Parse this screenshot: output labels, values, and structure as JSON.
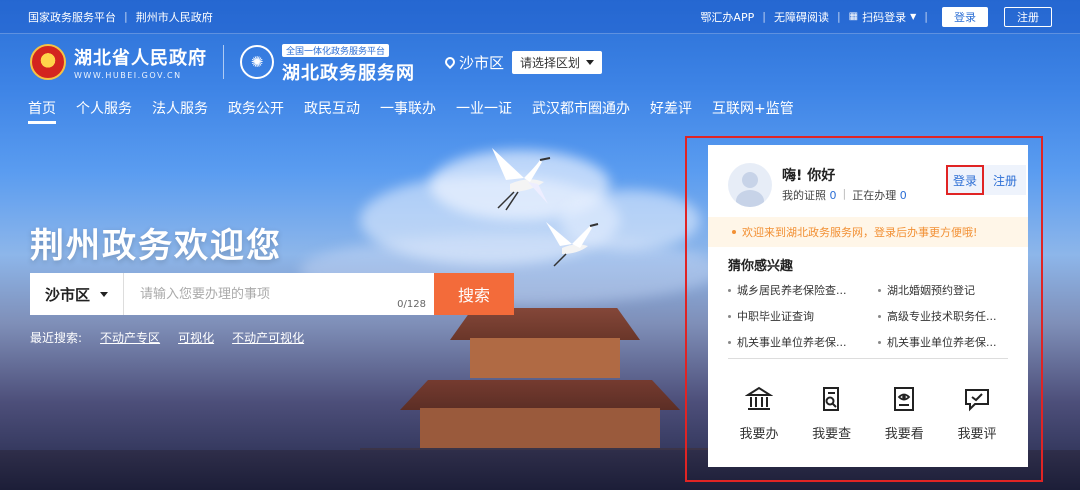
{
  "topbar": {
    "links": [
      "国家政务服务平台",
      "荆州市人民政府"
    ],
    "separator": "|",
    "app": "鄂汇办APP",
    "accessible": "无障碍阅读",
    "scan_login": "扫码登录",
    "login": "登录",
    "register": "注册"
  },
  "brand": {
    "gov_cn": "湖北省人民政府",
    "gov_en": "WWW.HUBEI.GOV.CN",
    "svc_tag": "全国一体化政务服务平台",
    "svc_title": "湖北政务服务网",
    "location": "沙市区",
    "area_select": "请选择区划"
  },
  "nav": [
    "首页",
    "个人服务",
    "法人服务",
    "政务公开",
    "政民互动",
    "一事联办",
    "一业一证",
    "武汉都市圈通办",
    "好差评",
    "互联网+监管"
  ],
  "hero": {
    "welcome": "荆州政务欢迎您"
  },
  "search": {
    "region": "沙市区",
    "placeholder": "请输入您要办理的事项",
    "counter": "0/128",
    "button": "搜索"
  },
  "recent": {
    "label": "最近搜索:",
    "items": [
      "不动产专区",
      "可视化",
      "不动产可视化"
    ]
  },
  "panel": {
    "greeting": "嗨! 你好",
    "cert_label": "我的证照",
    "cert_count": "0",
    "pending_label": "正在办理",
    "pending_count": "0",
    "login": "登录",
    "register": "注册",
    "notice": "欢迎来到湖北政务服务网，登录后办事更方便哦!",
    "interest_title": "猜你感兴趣",
    "recommendations": [
      "城乡居民养老保险查...",
      "湖北婚姻预约登记",
      "中职毕业证查询",
      "高级专业技术职务任...",
      "机关事业单位养老保...",
      "机关事业单位养老保..."
    ],
    "actions": [
      "我要办",
      "我要查",
      "我要看",
      "我要评"
    ]
  },
  "colors": {
    "primary": "#2d6fd5",
    "search_button": "#f36b3a",
    "highlight": "#e02424",
    "notice": "#f29034"
  }
}
